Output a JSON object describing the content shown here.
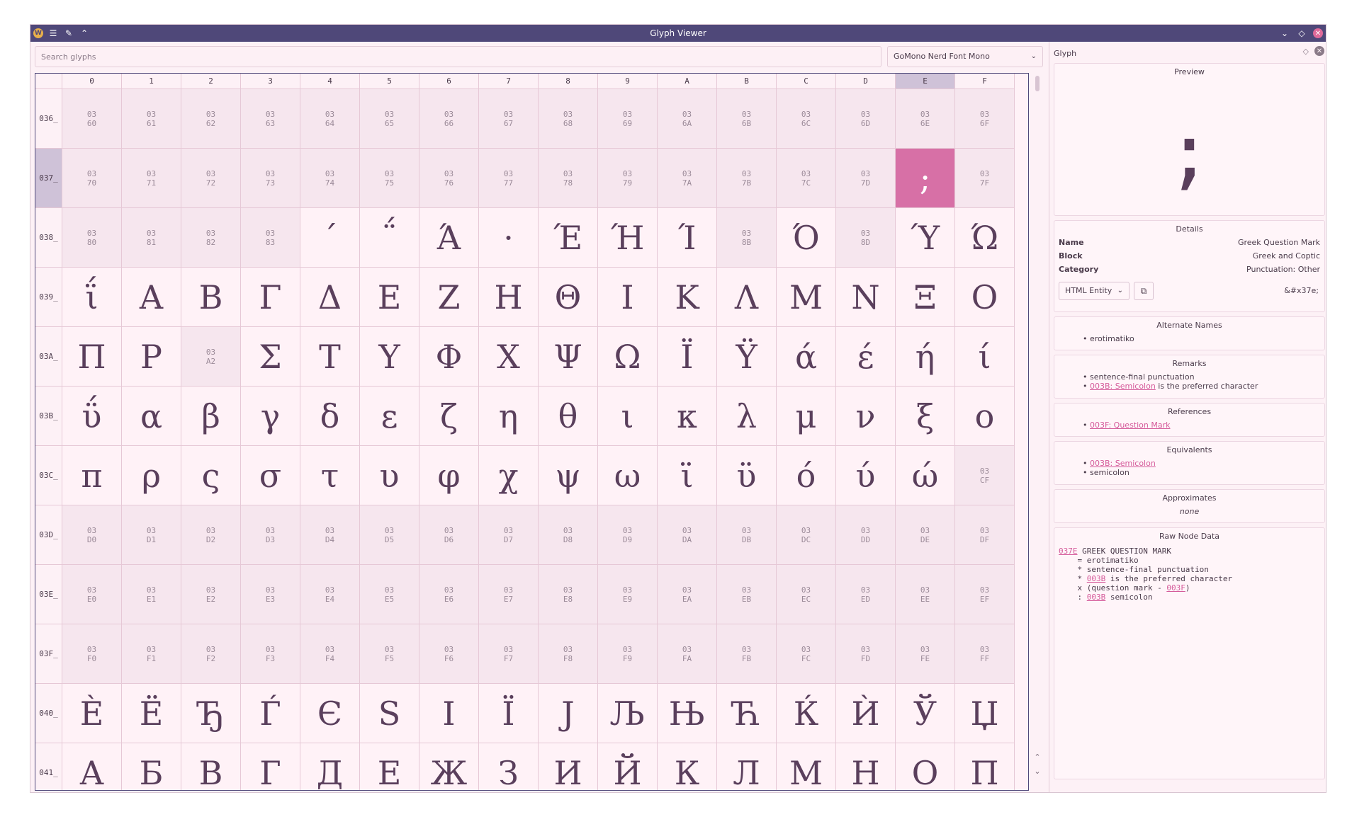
{
  "window": {
    "title": "Glyph Viewer"
  },
  "search": {
    "placeholder": "Search glyphs"
  },
  "font_selector": {
    "value": "GoMono Nerd Font Mono"
  },
  "grid": {
    "columns": [
      "0",
      "1",
      "2",
      "3",
      "4",
      "5",
      "6",
      "7",
      "8",
      "9",
      "A",
      "B",
      "C",
      "D",
      "E",
      "F"
    ],
    "selected_column": "E",
    "selected_row": "037_",
    "rows": [
      {
        "label": "036_",
        "cells": [
          {
            "c": "03\n60"
          },
          {
            "c": "03\n61"
          },
          {
            "c": "03\n62"
          },
          {
            "c": "03\n63"
          },
          {
            "c": "03\n64"
          },
          {
            "c": "03\n65"
          },
          {
            "c": "03\n66"
          },
          {
            "c": "03\n67"
          },
          {
            "c": "03\n68"
          },
          {
            "c": "03\n69"
          },
          {
            "c": "03\n6A"
          },
          {
            "c": "03\n6B"
          },
          {
            "c": "03\n6C"
          },
          {
            "c": "03\n6D"
          },
          {
            "c": "03\n6E"
          },
          {
            "c": "03\n6F"
          }
        ]
      },
      {
        "label": "037_",
        "cells": [
          {
            "c": "03\n70"
          },
          {
            "c": "03\n71"
          },
          {
            "c": "03\n72"
          },
          {
            "c": "03\n73"
          },
          {
            "c": "03\n74"
          },
          {
            "c": "03\n75"
          },
          {
            "c": "03\n76"
          },
          {
            "c": "03\n77"
          },
          {
            "c": "03\n78"
          },
          {
            "c": "03\n79"
          },
          {
            "c": "03\n7A"
          },
          {
            "c": "03\n7B"
          },
          {
            "c": "03\n7C"
          },
          {
            "c": "03\n7D"
          },
          {
            "g": ";",
            "sel": true
          },
          {
            "c": "03\n7F"
          }
        ]
      },
      {
        "label": "038_",
        "cells": [
          {
            "c": "03\n80"
          },
          {
            "c": "03\n81"
          },
          {
            "c": "03\n82"
          },
          {
            "c": "03\n83"
          },
          {
            "g": "΄"
          },
          {
            "g": "΅"
          },
          {
            "g": "Ά"
          },
          {
            "g": "·"
          },
          {
            "g": "Έ"
          },
          {
            "g": "Ή"
          },
          {
            "g": "Ί"
          },
          {
            "c": "03\n8B"
          },
          {
            "g": "Ό"
          },
          {
            "c": "03\n8D"
          },
          {
            "g": "Ύ"
          },
          {
            "g": "Ώ"
          }
        ]
      },
      {
        "label": "039_",
        "cells": [
          {
            "g": "ΐ"
          },
          {
            "g": "Α"
          },
          {
            "g": "Β"
          },
          {
            "g": "Γ"
          },
          {
            "g": "Δ"
          },
          {
            "g": "Ε"
          },
          {
            "g": "Ζ"
          },
          {
            "g": "Η"
          },
          {
            "g": "Θ"
          },
          {
            "g": "Ι"
          },
          {
            "g": "Κ"
          },
          {
            "g": "Λ"
          },
          {
            "g": "Μ"
          },
          {
            "g": "Ν"
          },
          {
            "g": "Ξ"
          },
          {
            "g": "Ο"
          }
        ]
      },
      {
        "label": "03A_",
        "cells": [
          {
            "g": "Π"
          },
          {
            "g": "Ρ"
          },
          {
            "c": "03\nA2"
          },
          {
            "g": "Σ"
          },
          {
            "g": "Τ"
          },
          {
            "g": "Υ"
          },
          {
            "g": "Φ"
          },
          {
            "g": "Χ"
          },
          {
            "g": "Ψ"
          },
          {
            "g": "Ω"
          },
          {
            "g": "Ϊ"
          },
          {
            "g": "Ϋ"
          },
          {
            "g": "ά"
          },
          {
            "g": "έ"
          },
          {
            "g": "ή"
          },
          {
            "g": "ί"
          }
        ]
      },
      {
        "label": "03B_",
        "cells": [
          {
            "g": "ΰ"
          },
          {
            "g": "α"
          },
          {
            "g": "β"
          },
          {
            "g": "γ"
          },
          {
            "g": "δ"
          },
          {
            "g": "ε"
          },
          {
            "g": "ζ"
          },
          {
            "g": "η"
          },
          {
            "g": "θ"
          },
          {
            "g": "ι"
          },
          {
            "g": "κ"
          },
          {
            "g": "λ"
          },
          {
            "g": "μ"
          },
          {
            "g": "ν"
          },
          {
            "g": "ξ"
          },
          {
            "g": "ο"
          }
        ]
      },
      {
        "label": "03C_",
        "cells": [
          {
            "g": "π"
          },
          {
            "g": "ρ"
          },
          {
            "g": "ς"
          },
          {
            "g": "σ"
          },
          {
            "g": "τ"
          },
          {
            "g": "υ"
          },
          {
            "g": "φ"
          },
          {
            "g": "χ"
          },
          {
            "g": "ψ"
          },
          {
            "g": "ω"
          },
          {
            "g": "ϊ"
          },
          {
            "g": "ϋ"
          },
          {
            "g": "ό"
          },
          {
            "g": "ύ"
          },
          {
            "g": "ώ"
          },
          {
            "c": "03\nCF"
          }
        ]
      },
      {
        "label": "03D_",
        "cells": [
          {
            "c": "03\nD0"
          },
          {
            "c": "03\nD1"
          },
          {
            "c": "03\nD2"
          },
          {
            "c": "03\nD3"
          },
          {
            "c": "03\nD4"
          },
          {
            "c": "03\nD5"
          },
          {
            "c": "03\nD6"
          },
          {
            "c": "03\nD7"
          },
          {
            "c": "03\nD8"
          },
          {
            "c": "03\nD9"
          },
          {
            "c": "03\nDA"
          },
          {
            "c": "03\nDB"
          },
          {
            "c": "03\nDC"
          },
          {
            "c": "03\nDD"
          },
          {
            "c": "03\nDE"
          },
          {
            "c": "03\nDF"
          }
        ]
      },
      {
        "label": "03E_",
        "cells": [
          {
            "c": "03\nE0"
          },
          {
            "c": "03\nE1"
          },
          {
            "c": "03\nE2"
          },
          {
            "c": "03\nE3"
          },
          {
            "c": "03\nE4"
          },
          {
            "c": "03\nE5"
          },
          {
            "c": "03\nE6"
          },
          {
            "c": "03\nE7"
          },
          {
            "c": "03\nE8"
          },
          {
            "c": "03\nE9"
          },
          {
            "c": "03\nEA"
          },
          {
            "c": "03\nEB"
          },
          {
            "c": "03\nEC"
          },
          {
            "c": "03\nED"
          },
          {
            "c": "03\nEE"
          },
          {
            "c": "03\nEF"
          }
        ]
      },
      {
        "label": "03F_",
        "cells": [
          {
            "c": "03\nF0"
          },
          {
            "c": "03\nF1"
          },
          {
            "c": "03\nF2"
          },
          {
            "c": "03\nF3"
          },
          {
            "c": "03\nF4"
          },
          {
            "c": "03\nF5"
          },
          {
            "c": "03\nF6"
          },
          {
            "c": "03\nF7"
          },
          {
            "c": "03\nF8"
          },
          {
            "c": "03\nF9"
          },
          {
            "c": "03\nFA"
          },
          {
            "c": "03\nFB"
          },
          {
            "c": "03\nFC"
          },
          {
            "c": "03\nFD"
          },
          {
            "c": "03\nFE"
          },
          {
            "c": "03\nFF"
          }
        ]
      },
      {
        "label": "040_",
        "cells": [
          {
            "g": "Ѐ"
          },
          {
            "g": "Ё"
          },
          {
            "g": "Ђ"
          },
          {
            "g": "Ѓ"
          },
          {
            "g": "Є"
          },
          {
            "g": "Ѕ"
          },
          {
            "g": "І"
          },
          {
            "g": "Ї"
          },
          {
            "g": "Ј"
          },
          {
            "g": "Љ"
          },
          {
            "g": "Њ"
          },
          {
            "g": "Ћ"
          },
          {
            "g": "Ќ"
          },
          {
            "g": "Ѝ"
          },
          {
            "g": "Ў"
          },
          {
            "g": "Џ"
          }
        ]
      },
      {
        "label": "041_",
        "cells": [
          {
            "g": "А"
          },
          {
            "g": "Б"
          },
          {
            "g": "В"
          },
          {
            "g": "Г"
          },
          {
            "g": "Д"
          },
          {
            "g": "Е"
          },
          {
            "g": "Ж"
          },
          {
            "g": "З"
          },
          {
            "g": "И"
          },
          {
            "g": "Й"
          },
          {
            "g": "К"
          },
          {
            "g": "Л"
          },
          {
            "g": "М"
          },
          {
            "g": "Н"
          },
          {
            "g": "О"
          },
          {
            "g": "П"
          }
        ]
      }
    ]
  },
  "panel": {
    "title": "Glyph",
    "preview": {
      "title": "Preview",
      "glyph": ";"
    },
    "details": {
      "title": "Details",
      "name_label": "Name",
      "name": "Greek Question Mark",
      "block_label": "Block",
      "block": "Greek and Coptic",
      "category_label": "Category",
      "category": "Punctuation: Other",
      "format": "HTML Entity",
      "entity": "&#x37e;"
    },
    "alternate_names": {
      "title": "Alternate Names",
      "items": [
        "erotimatiko"
      ]
    },
    "remarks": {
      "title": "Remarks",
      "item1": "sentence-final punctuation",
      "item2_link": "003B: Semicolon",
      "item2_rest": " is the preferred character"
    },
    "references": {
      "title": "References",
      "link": "003F: Question Mark"
    },
    "equivalents": {
      "title": "Equivalents",
      "link": "003B: Semicolon",
      "item2": "semicolon"
    },
    "approximates": {
      "title": "Approximates",
      "value": "none"
    },
    "raw": {
      "title": "Raw Node Data",
      "l1_code": "037E",
      "l1_rest": " GREEK QUESTION MARK",
      "l2": "    = erotimatiko",
      "l3": "    * sentence-final punctuation",
      "l4_pre": "    * ",
      "l4_code": "003B",
      "l4_rest": " is the preferred character",
      "l5_pre": "    x (question mark - ",
      "l5_code": "003F",
      "l5_rest": ")",
      "l6_pre": "    : ",
      "l6_code": "003B",
      "l6_rest": " semicolon"
    }
  },
  "colors": {
    "titlebar": "#4f4879",
    "selected_cell": "#d770a6",
    "accent_link": "#d55a9a",
    "background": "#fdf1f6"
  }
}
